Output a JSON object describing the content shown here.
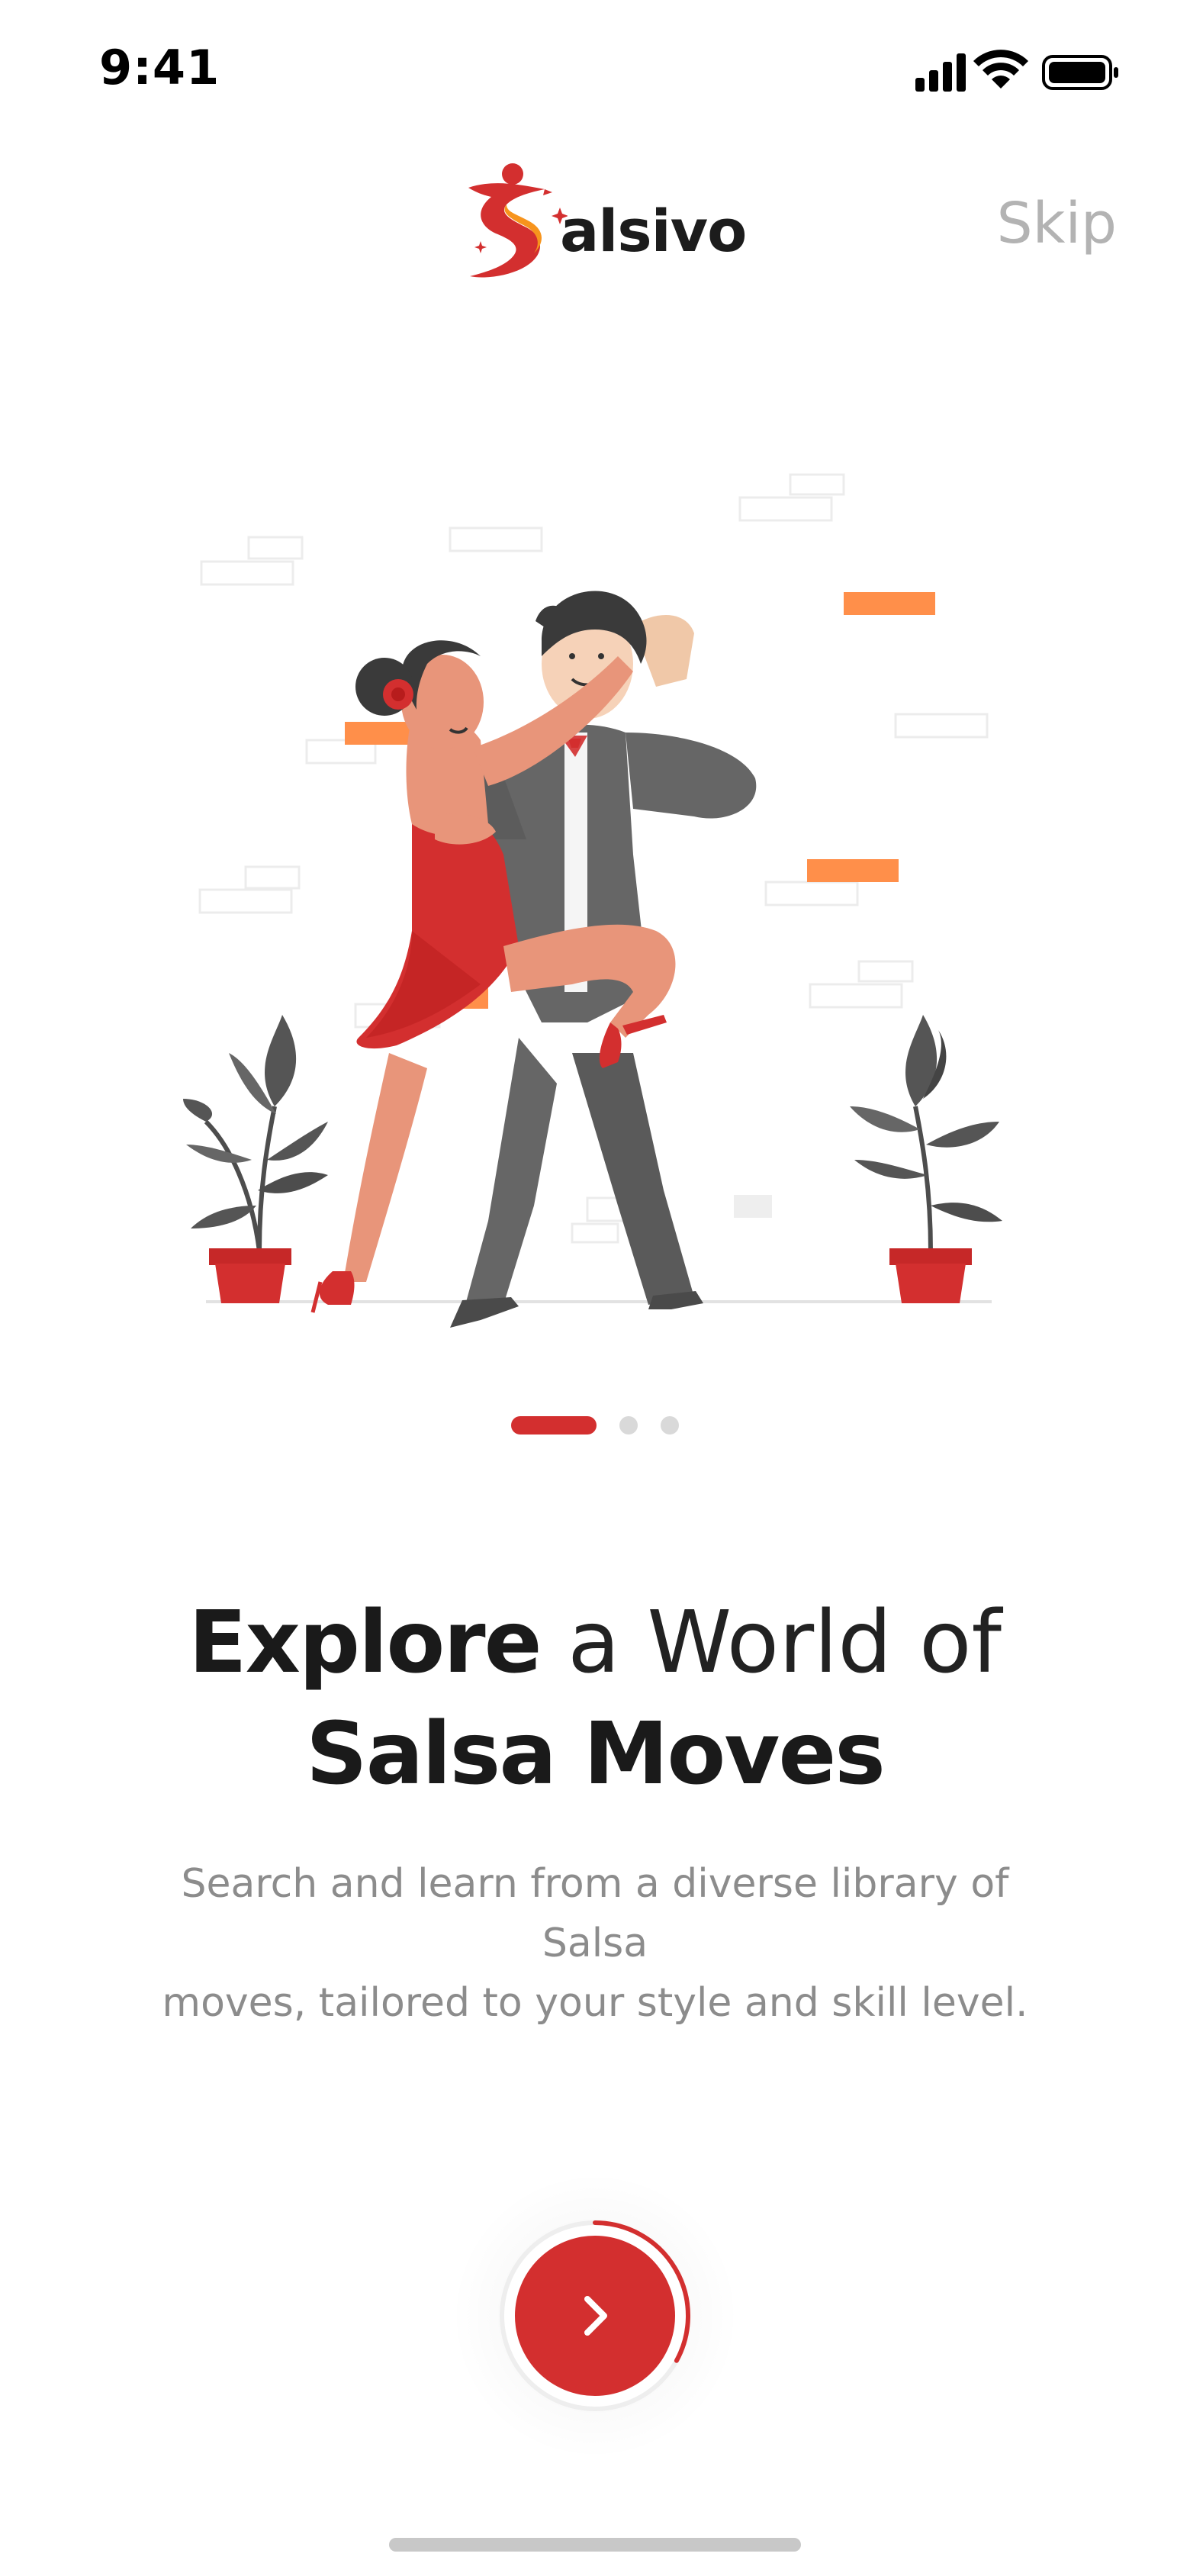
{
  "status_bar": {
    "time": "9:41",
    "icons": [
      "signal-icon",
      "wifi-icon",
      "battery-icon"
    ]
  },
  "header": {
    "logo_text": "alsivo",
    "skip_label": "Skip"
  },
  "illustration": {
    "name": "salsa-dancing-couple"
  },
  "pager": {
    "total": 3,
    "active_index": 0
  },
  "headline": {
    "line1_bold": "Explore",
    "line1_light": " a World of",
    "line2_bold": "Salsa Moves"
  },
  "subtitle": {
    "line1": "Search and learn from a diverse library of Salsa",
    "line2": "moves, tailored to your style and skill level."
  },
  "next_button": {
    "icon": "chevron-right-icon",
    "progress": 0.33
  },
  "colors": {
    "brand_red": "#d32f2f",
    "brand_orange": "#f7941d",
    "skip_gray": "#b3b3b3",
    "subtitle_gray": "#8c8c8c",
    "inactive_dot": "#d9d9d9"
  }
}
